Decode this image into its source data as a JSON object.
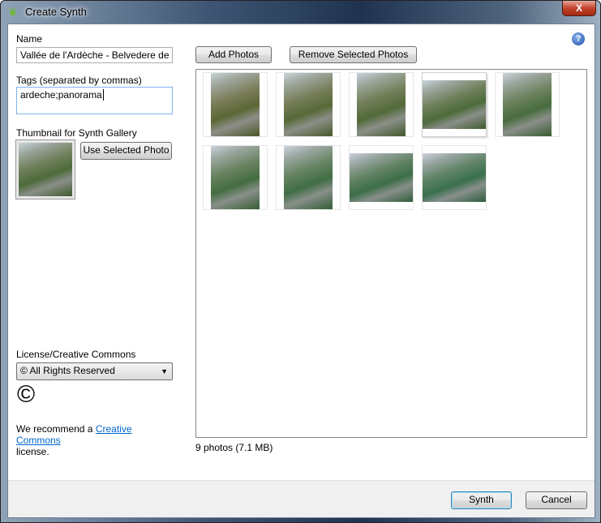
{
  "window": {
    "title": "Create Synth",
    "close_label": "X",
    "app_icon": "photosynth-leaf-icon"
  },
  "form": {
    "name_label": "Name",
    "name_value": "Vallée de l'Ardèche - Belvedere de la M",
    "tags_label": "Tags (separated by commas)",
    "tags_value": "ardeche;panorama",
    "thumbnail_label": "Thumbnail for Synth Gallery",
    "use_selected_label": "Use Selected Photo",
    "license_label": "License/Creative Commons",
    "license_value": "© All Rights Reserved",
    "license_symbol": "©",
    "recommend_prefix": "We recommend a ",
    "recommend_link": "Creative Commons",
    "recommend_suffix": "license."
  },
  "photos": {
    "add_label": "Add Photos",
    "remove_label": "Remove Selected Photos",
    "status": "9 photos (7.1 MB)",
    "items": [
      {
        "orientation": "portrait"
      },
      {
        "orientation": "portrait"
      },
      {
        "orientation": "portrait"
      },
      {
        "orientation": "landscape",
        "selected": true
      },
      {
        "orientation": "portrait"
      },
      {
        "orientation": "portrait"
      },
      {
        "orientation": "portrait"
      },
      {
        "orientation": "landscape"
      },
      {
        "orientation": "landscape"
      }
    ]
  },
  "footer": {
    "synth_label": "Synth",
    "cancel_label": "Cancel"
  }
}
